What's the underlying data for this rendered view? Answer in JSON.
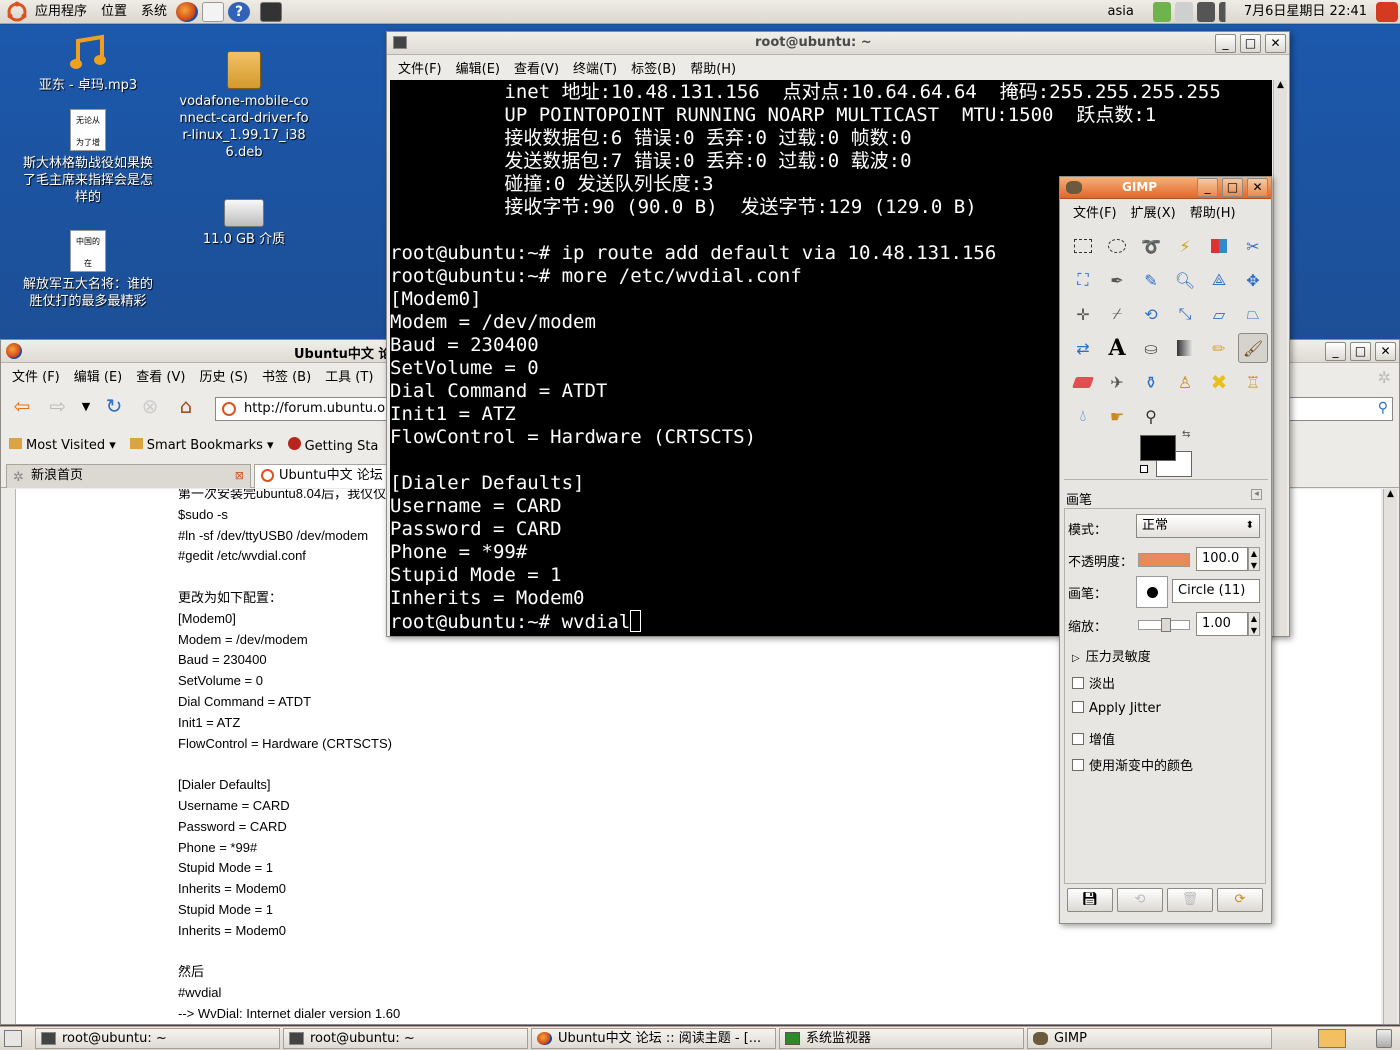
{
  "top_panel": {
    "menus": [
      "应用程序",
      "位置",
      "系统"
    ],
    "user": "asia",
    "datetime": "7月6日星期日 22:41"
  },
  "desktop": {
    "icons": [
      {
        "label": "亚东 - 卓玛.mp3",
        "icon": "music-file-icon"
      },
      {
        "label": "斯大林格勒战役如果换了毛主席来指挥会是怎样的",
        "icon": "text-document-icon",
        "preview": [
          "无论从",
          "为了增"
        ]
      },
      {
        "label": "解放军五大名将：谁的胜仗打的最多最精彩",
        "icon": "text-document-icon",
        "preview": [
          "中国的",
          "在"
        ]
      },
      {
        "label": "vodafone-mobile-connect-card-driver-for-linux_1.99.17_i386.deb",
        "icon": "package-icon"
      },
      {
        "label": "11.0 GB 介质",
        "icon": "drive-icon"
      }
    ]
  },
  "firefox": {
    "title": "Ubuntu中文 论",
    "menus": [
      "文件 (F)",
      "编辑 (E)",
      "查看 (V)",
      "历史 (S)",
      "书签 (B)",
      "工具 (T)"
    ],
    "url": "http://forum.ubuntu.org",
    "bookmarks": [
      "Most Visited",
      "Smart Bookmarks",
      "Getting Sta"
    ],
    "tabs": [
      "新浪首页",
      "Ubuntu中文 论坛"
    ],
    "post_lines": [
      "第一次安装完ubuntu8.04后，我仅仅",
      "$sudo -s",
      "#ln -sf /dev/ttyUSB0 /dev/modem",
      "#gedit /etc/wvdial.conf",
      "",
      "更改为如下配置：",
      "[Modem0]",
      "Modem = /dev/modem",
      "Baud = 230400",
      "SetVolume = 0",
      "Dial Command = ATDT",
      "Init1 = ATZ",
      "FlowControl = Hardware (CRTSCTS)",
      "",
      "[Dialer Defaults]",
      "Username = CARD",
      "Password = CARD",
      "Phone = *99#",
      "Stupid Mode = 1",
      "Inherits = Modem0",
      "Stupid Mode = 1",
      "Inherits = Modem0",
      "",
      "然后",
      "#wvdial",
      "--> WvDial: Internet dialer version 1.60"
    ]
  },
  "terminal": {
    "title": "root@ubuntu: ~",
    "menus": [
      "文件(F)",
      "编辑(E)",
      "查看(V)",
      "终端(T)",
      "标签(B)",
      "帮助(H)"
    ],
    "lines": [
      "          inet 地址:10.48.131.156  点对点:10.64.64.64  掩码:255.255.255.255",
      "          UP POINTOPOINT RUNNING NOARP MULTICAST  MTU:1500  跃点数:1",
      "          接收数据包:6 错误:0 丢弃:0 过载:0 帧数:0",
      "          发送数据包:7 错误:0 丢弃:0 过载:0 载波:0",
      "          碰撞:0 发送队列长度:3",
      "          接收字节:90 (90.0 B)  发送字节:129 (129.0 B)",
      "",
      "root@ubuntu:~# ip route add default via 10.48.131.156",
      "root@ubuntu:~# more /etc/wvdial.conf",
      "[Modem0]",
      "Modem = /dev/modem",
      "Baud = 230400",
      "SetVolume = 0",
      "Dial Command = ATDT",
      "Init1 = ATZ",
      "FlowControl = Hardware (CRTSCTS)",
      "",
      "[Dialer Defaults]",
      "Username = CARD",
      "Password = CARD",
      "Phone = *99#",
      "Stupid Mode = 1",
      "Inherits = Modem0"
    ],
    "prompt_line": "root@ubuntu:~# wvdial"
  },
  "gimp": {
    "title": "GIMP",
    "menus": [
      "文件(F)",
      "扩展(X)",
      "帮助(H)"
    ],
    "panel_title": "画笔",
    "mode_label": "模式：",
    "mode_value": "正常",
    "opacity_label": "不透明度：",
    "opacity_value": "100.0",
    "opacity_fraction": 1.0,
    "brush_label": "画笔：",
    "brush_value": "Circle (11)",
    "scale_label": "缩放：",
    "scale_value": "1.00",
    "pressure_label": "压力灵敏度",
    "options": [
      "淡出",
      "Apply Jitter",
      "增值",
      "使用渐变中的颜色"
    ],
    "fg_color": "#000000",
    "bg_color": "#ffffff"
  },
  "taskbar": {
    "items": [
      "root@ubuntu: ~",
      "root@ubuntu: ~",
      "Ubuntu中文 论坛 :: 阅读主题 - [...",
      "系统监视器",
      "GIMP"
    ]
  },
  "colors": {
    "desktop": "#1c55a4",
    "panel": "#e6e3dd",
    "gimp_title": "#e97a3c",
    "terminal_bg": "#000000"
  }
}
